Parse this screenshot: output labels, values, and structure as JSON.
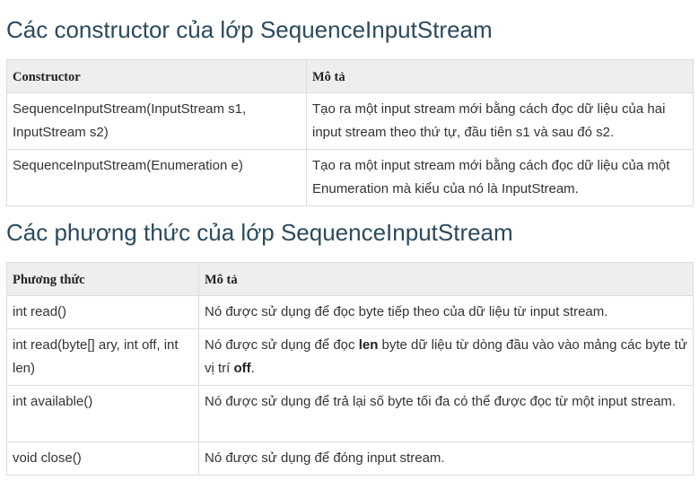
{
  "section1": {
    "title": "Các constructor của lớp SequenceInputStream",
    "headers": [
      "Constructor",
      "Mô tả"
    ],
    "rows": [
      {
        "name": "SequenceInputStream(InputStream s1, InputStream s2)",
        "desc": "Tạo ra một input stream mới bằng cách đọc dữ liệu của hai input stream theo thứ tự, đầu tiên s1 và sau đó s2."
      },
      {
        "name": "SequenceInputStream(Enumeration e)",
        "desc": "Tạo ra một input stream mới bằng cách đọc dữ liệu của một Enumeration mà kiểu của nó là InputStream."
      }
    ]
  },
  "section2": {
    "title": "Các phương thức của lớp SequenceInputStream",
    "headers": [
      "Phương thức",
      "Mô tả"
    ],
    "rows": [
      {
        "name": "int read()",
        "desc": "Nó được sử dụng để đọc byte tiếp theo của dữ liệu từ input stream."
      },
      {
        "name": "int read(byte[] ary, int off, int len)",
        "desc_parts": [
          "Nó được sử dụng để đọc ",
          "len",
          " byte dữ liệu từ dòng đầu vào vào mảng các byte tử vị trí ",
          "off",
          "."
        ]
      },
      {
        "name": "int available()",
        "desc": "Nó được sử dụng để trả lại số byte tối đa có thể được đọc từ một input stream."
      },
      {
        "name": "void close()",
        "desc": "Nó được sử dụng để đóng input stream."
      }
    ]
  }
}
